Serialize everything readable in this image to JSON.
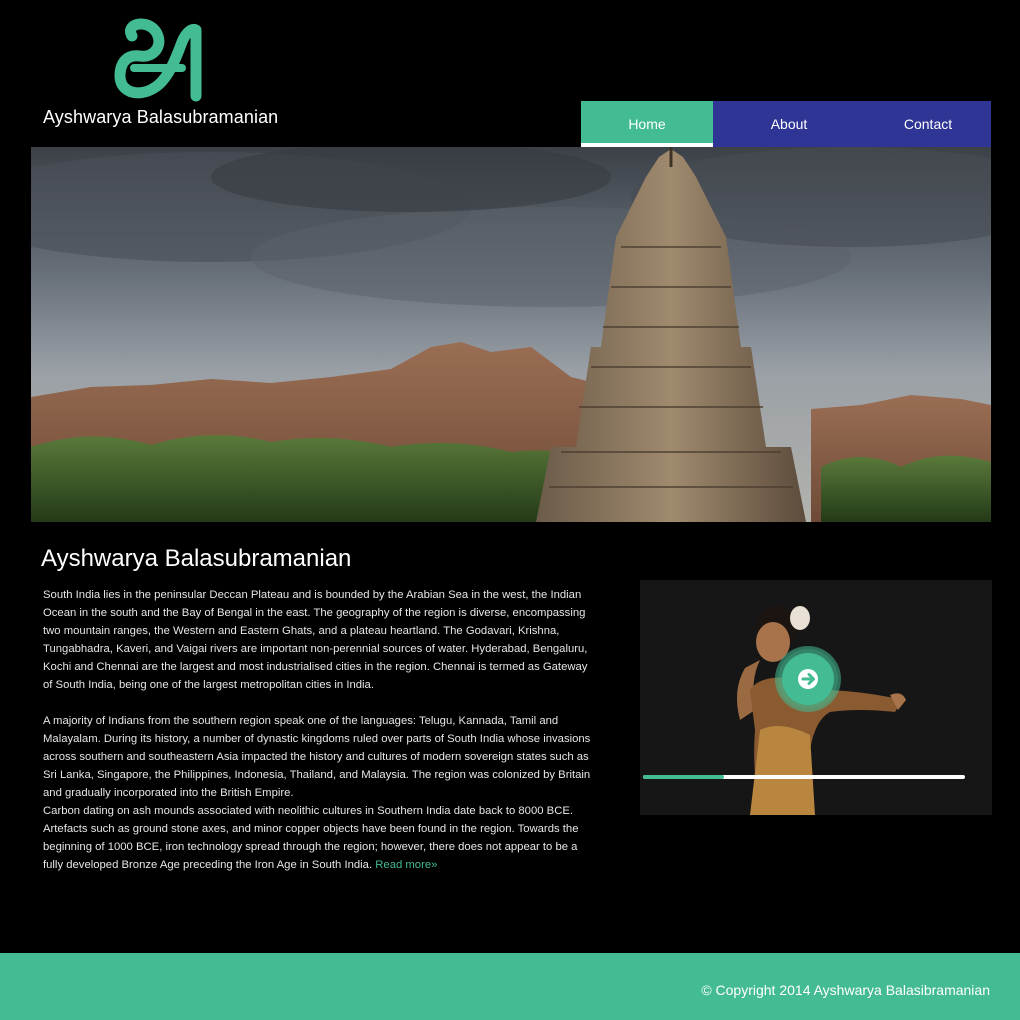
{
  "site": {
    "logo_text": "Ayshwarya Balasubramanian",
    "logo_icon": "tamil-letter-a-icon",
    "accent_color": "#43bb93",
    "nav_color": "#2e3595"
  },
  "nav": {
    "home": "Home",
    "about": "About",
    "contact": "Contact",
    "active": "Home"
  },
  "hero": {
    "image": "temple-landscape-photo"
  },
  "main": {
    "title": "Ayshwarya Balasubramanian",
    "paragraph1": "South India lies in the peninsular Deccan Plateau and is bounded by the Arabian Sea in the west, the Indian Ocean in the south and the Bay of Bengal in the east. The geography of the region is diverse, encompassing two mountain ranges, the Western and Eastern Ghats, and a plateau heartland. The Godavari, Krishna, Tungabhadra, Kaveri, and Vaigai rivers are important non-perennial sources of water. Hyderabad, Bengaluru, Kochi and Chennai are the largest and most industrialised cities in the region. Chennai is termed as Gateway of South India, being one of the largest metropolitan cities in India.",
    "paragraph2": "A majority of Indians from the southern region speak one of the languages: Telugu, Kannada, Tamil and Malayalam. During its history, a number of dynastic kingdoms ruled over parts of South India whose invasions across southern and southeastern Asia impacted the history and cultures of modern sovereign states such as Sri Lanka, Singapore, the Philippines, Indonesia, Thailand, and Malaysia. The region was colonized by Britain and gradually incorporated into the British Empire.",
    "paragraph3": "Carbon dating on ash mounds associated with neolithic cultures in Southern India date back to 8000 BCE. Artefacts such as ground stone axes, and minor copper objects have been found in the region. Towards the beginning of 1000 BCE, iron technology spread through the region; however, there does not appear to be a fully developed Bronze Age preceding the Iron Age in South India.",
    "read_more": "Read more»"
  },
  "video": {
    "thumbnail": "dancer-photo",
    "play_icon": "arrow-right-icon",
    "progress": 0.25
  },
  "footer": {
    "copyright": "© Copyright 2014  Ayshwarya Balasibramanian"
  }
}
